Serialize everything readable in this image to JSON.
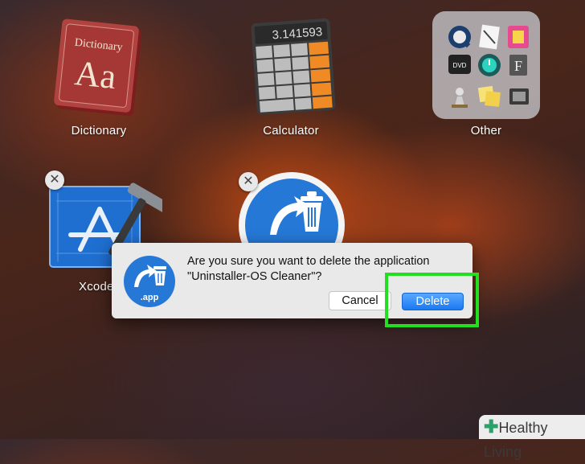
{
  "launchpad": {
    "apps": [
      {
        "label": "Dictionary",
        "book_title": "Dictionary",
        "book_glyph": "Aa"
      },
      {
        "label": "Calculator",
        "display": "3.141593"
      },
      {
        "label": "Other",
        "folder_items": [
          "quicktime-icon",
          "textedit-icon",
          "color-picker-icon",
          "dvd-player-icon",
          "time-machine-icon",
          "font-book-icon",
          "chess-icon",
          "stickies-icon",
          "screenshot-icon"
        ]
      },
      {
        "label": "Xcode"
      },
      {
        "label": "Uninstaller-OS Cleaner"
      }
    ]
  },
  "dialog": {
    "message_line1": "Are you sure you want to delete the application",
    "message_line2": "\"Uninstaller-OS Cleaner\"?",
    "icon_label": ".app",
    "cancel_label": "Cancel",
    "delete_label": "Delete"
  },
  "watermark": {
    "text": "Healthy Living"
  },
  "colors": {
    "highlight": "#20e020",
    "delete_button": "#1a78f0",
    "dialog_bg": "#e9e9e9"
  }
}
